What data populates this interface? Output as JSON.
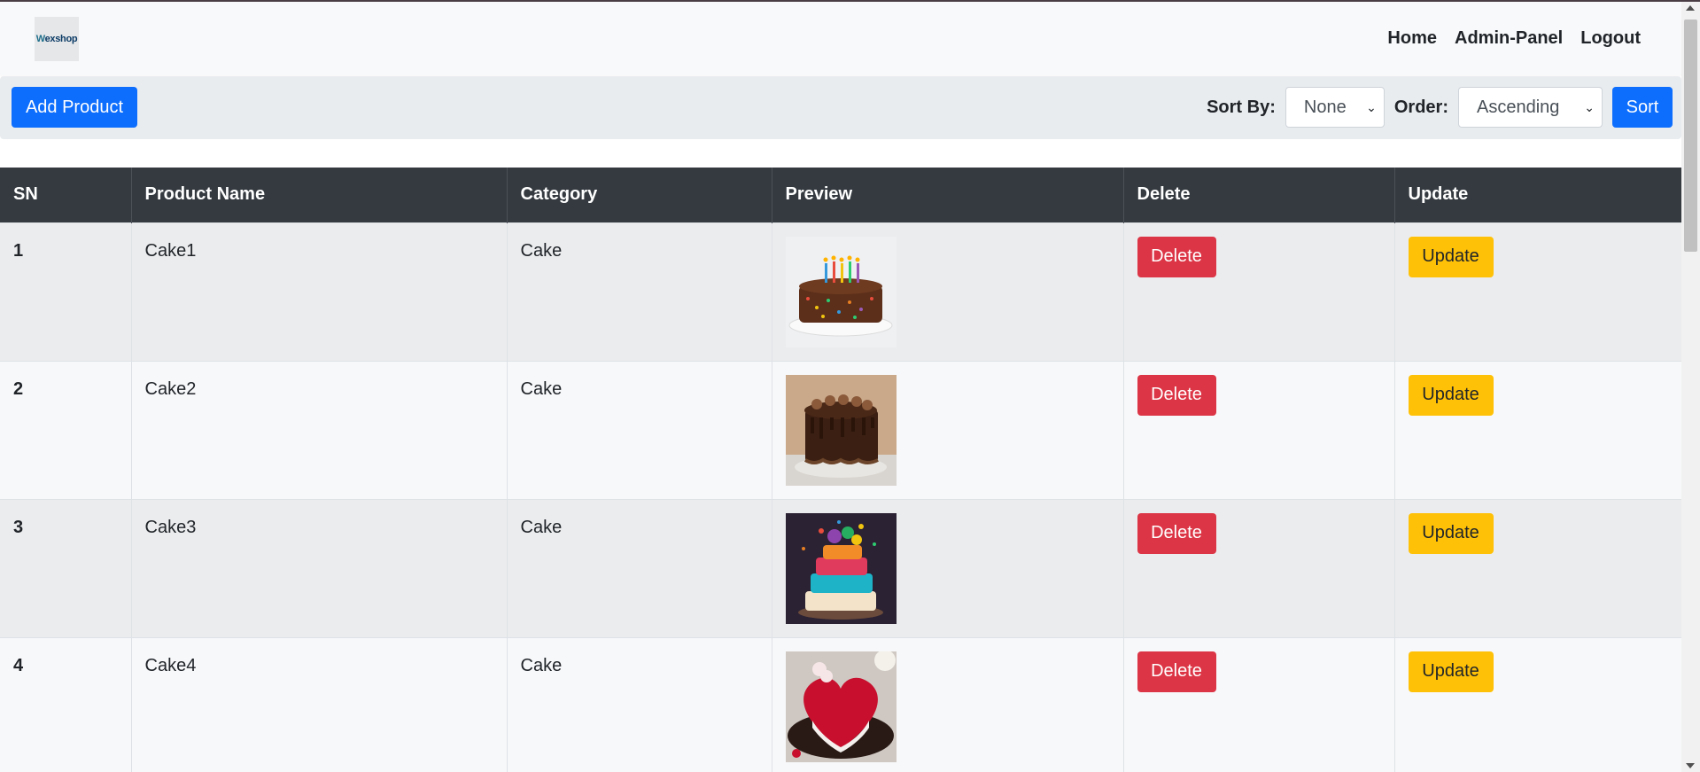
{
  "logo": {
    "text_a": "W",
    "text_b": "exshop"
  },
  "nav": {
    "home": "Home",
    "admin": "Admin-Panel",
    "logout": "Logout"
  },
  "toolbar": {
    "add_label": "Add Product",
    "sort_by_label": "Sort By:",
    "sort_by_value": "None",
    "order_label": "Order:",
    "order_value": "Ascending",
    "sort_label": "Sort"
  },
  "table": {
    "headers": [
      "SN",
      "Product Name",
      "Category",
      "Preview",
      "Delete",
      "Update"
    ],
    "rows": [
      {
        "sn": "1",
        "name": "Cake1",
        "category": "Cake",
        "delete": "Delete",
        "update": "Update"
      },
      {
        "sn": "2",
        "name": "Cake2",
        "category": "Cake",
        "delete": "Delete",
        "update": "Update"
      },
      {
        "sn": "3",
        "name": "Cake3",
        "category": "Cake",
        "delete": "Delete",
        "update": "Update"
      },
      {
        "sn": "4",
        "name": "Cake4",
        "category": "Cake",
        "delete": "Delete",
        "update": "Update"
      }
    ]
  },
  "colors": {
    "primary": "#0d6efd",
    "danger": "#dc3545",
    "warning": "#ffc107",
    "header_dark": "#343a40"
  }
}
